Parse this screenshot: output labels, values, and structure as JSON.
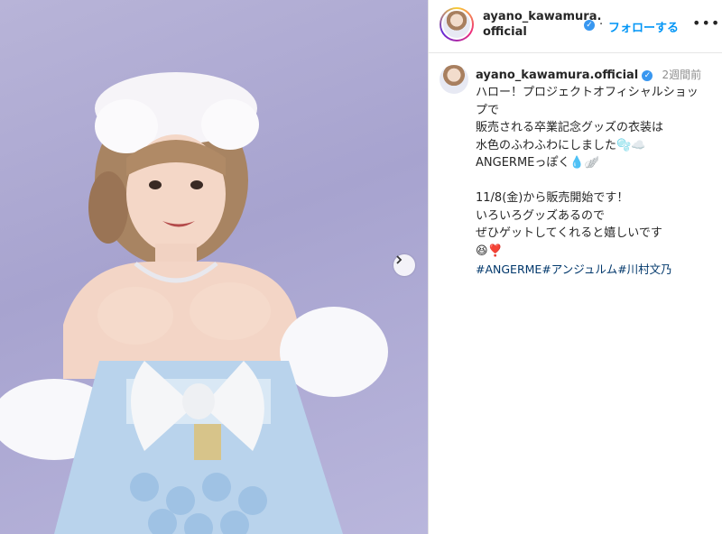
{
  "post": {
    "username": "ayano_kawamura.official",
    "header_name_line1": "ayano_kawamura.",
    "header_name_line2": "official",
    "follow_label": "フォローする",
    "time_ago": "2週間前",
    "caption": "ハロー！プロジェクトオフィシャルショップで\n販売される卒業記念グッズの衣装は\n水色のふわふわにしました🫧☁️\nANGERMEっぽく💧🪽\n\n11/8(金)から販売開始です！\nいろいろグッズあるので\nぜひゲットしてくれると嬉しいです\n😆❣️",
    "hashtags": [
      "#ANGERME",
      "#アンジュルム",
      "#川村文乃"
    ]
  },
  "icons": {
    "verified": "verified-badge-icon",
    "more": "more-options-icon",
    "next": "chevron-right-icon"
  },
  "colors": {
    "link_blue": "#0095f6",
    "hashtag": "#00376b",
    "verified": "#3897f0",
    "backdrop": "#b0acd6"
  }
}
